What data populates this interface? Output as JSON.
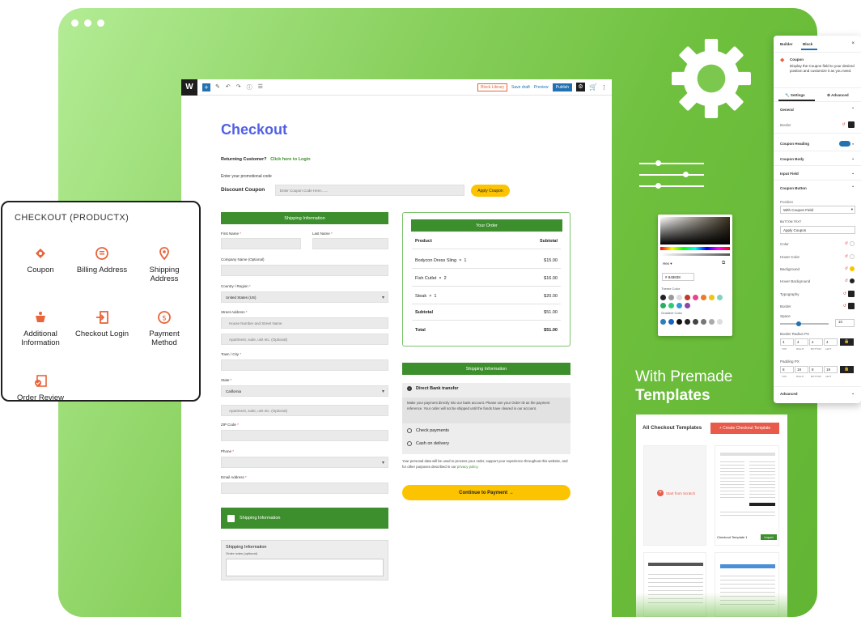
{
  "editor": {
    "toolbar": {
      "block_library": "Block Library",
      "save_draft": "Save draft",
      "preview": "Preview",
      "publish": "Publish"
    },
    "page_title": "Checkout",
    "returning": {
      "text": "Returning Customer?",
      "link": "Click here to Login"
    },
    "promo_text": "Enter your promotional code",
    "coupon": {
      "label": "Discount Coupon",
      "placeholder": "Enter Coupon Code Here.......",
      "button": "Apply Coupon"
    },
    "shipping_header": "Shipping Information",
    "fields": {
      "first_name": "First Name",
      "last_name": "Last Name",
      "company": "Company Name (Optional)",
      "country": "Country / Region",
      "country_value": "United States (US)",
      "street": "Street Address",
      "street_ph1": "House Number and Street Name",
      "street_ph2": "Apartment, suite, unit etc. (Optional)",
      "town": "Town / City",
      "state": "State",
      "state_value": "California",
      "state_ph": "Apartment, suite, unit etc. (Optional)",
      "zip": "ZIP Code",
      "phone": "Phone",
      "email": "Email Address"
    },
    "shipping_checkbox": "Shipping Information",
    "notes": {
      "title": "Shipping Information",
      "sub": "Order notes (optional)"
    },
    "order": {
      "header": "Your Order",
      "col_product": "Product",
      "col_subtotal": "Subtotal",
      "items": [
        {
          "name": "Bodycon Dress Sling",
          "qty": "1",
          "price": "$15.00"
        },
        {
          "name": "Fish Cutlet",
          "qty": "2",
          "price": "$16.00"
        },
        {
          "name": "Steak",
          "qty": "1",
          "price": "$20.00"
        }
      ],
      "subtotal_label": "Subtotal",
      "subtotal_value": "$51.00",
      "total_label": "Total",
      "total_value": "$51.00"
    },
    "payment": {
      "header": "Shipping Information",
      "options": [
        "Direct Bank transfer",
        "Check payments",
        "Cash on delivery"
      ],
      "bank_desc": "Make your payment directly into our bank account. Please use your Order ID as the payment reference. Your order will not be shipped until the funds have cleared in our account.",
      "privacy": "Your personal data will be used to process your order, support your experience throughout this website, and for other purposes described in our",
      "privacy_link": "privacy policy.",
      "cta": "Continue to Payment →"
    }
  },
  "card": {
    "title": "CHECKOUT  (PRODUCTX)",
    "items": [
      "Coupon",
      "Billing Address",
      "Shipping Address",
      "Additional Information",
      "Checkout Login",
      "Payment Method",
      "Order Review"
    ]
  },
  "picker": {
    "format": "Hex",
    "hex": "# 848838",
    "theme_label": "Theme Color",
    "gradient_label": "Gradient Color"
  },
  "premade": {
    "line1": "With Premade",
    "line2": "Templates"
  },
  "templates": {
    "heading": "All Checkout Templates",
    "create": "+ Create Checkout Template",
    "start": "Start from Scratch",
    "card_name": "Checkout Template 1",
    "import": "Import"
  },
  "panel": {
    "tabs": [
      "Builder",
      "Block"
    ],
    "block_name": "Coupon",
    "block_desc": "Display the Coupon field to your desired position and customize it as you need.",
    "sub_tabs": [
      "Settings",
      "Advanced"
    ],
    "sections": [
      "General",
      "Coupon Heading",
      "Coupon Body",
      "Input Field",
      "Coupon Button",
      "Advanced"
    ],
    "border": "Border",
    "position_label": "Position",
    "position_value": "With Coupon Field",
    "button_text_label": "BUTTON TEXT",
    "button_text_value": "Apply Coupon",
    "props": [
      "Color",
      "Hover Color",
      "Background",
      "Hover Background",
      "Typography",
      "Border"
    ],
    "space_label": "Space",
    "space_value": "10",
    "radius_label": "Border Radius",
    "radius_values": [
      "4",
      "4",
      "4",
      "4"
    ],
    "padding_label": "Padding",
    "padding_values": [
      "8",
      "19",
      "8",
      "19"
    ],
    "sides": [
      "TOP",
      "RIGHT",
      "BOTTOM",
      "LEFT"
    ],
    "unit": "PX"
  },
  "colors": {
    "brand_green": "#3d8f2d",
    "accent_yellow": "#fcc400",
    "title_blue": "#5160e6",
    "orange_icon": "#e8643a"
  }
}
